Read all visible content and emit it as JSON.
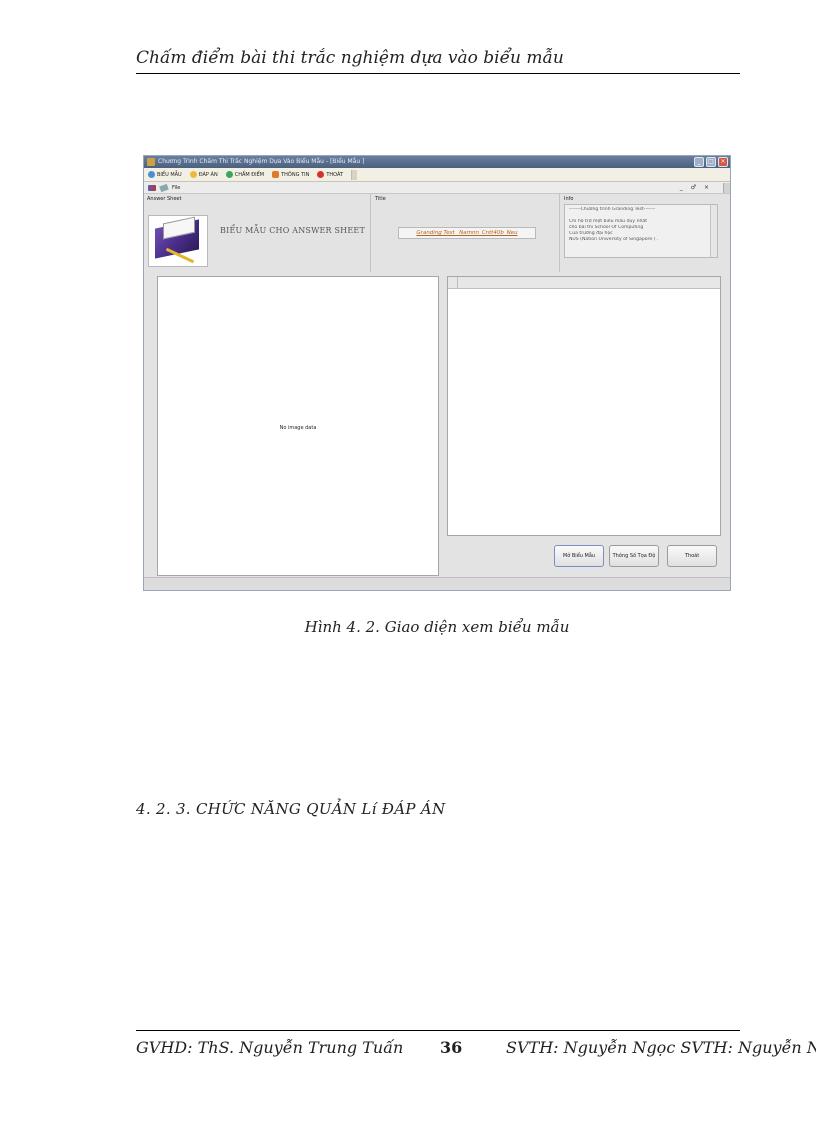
{
  "header": {
    "title": "Chấm điểm bài thi trắc nghiệm dựa vào biểu mẫu"
  },
  "app": {
    "window_title": "Chương Trình Chấm Thi Trắc Nghiệm Dựa Vào Biểu Mẫu - [Biểu Mẫu ]",
    "menu": [
      {
        "label": "BIỂU MẪU",
        "icon": "form-icon"
      },
      {
        "label": "ĐÁP ÁN",
        "icon": "answer-icon"
      },
      {
        "label": "CHẤM ĐIỂM",
        "icon": "grade-icon"
      },
      {
        "label": "THÔNG TIN",
        "icon": "info-icon"
      },
      {
        "label": "THOÁT",
        "icon": "exit-icon"
      }
    ],
    "subbar": {
      "file_label": "File",
      "controls": "_ ♂ ×"
    },
    "panels": {
      "answer_sheet_label": "Answer Sheet",
      "title_label": "Title",
      "info_label": "Info"
    },
    "form_caption": "BIỂU MẪU CHO ANSWER SHEET",
    "title_value": "Granding Test _Namnn_Cntt40b_Neu",
    "info_lines": [
      "-------Chương trình Granding Test-------",
      "",
      "Chỉ hỗ trợ một biểu mẫu duy nhất",
      "cho bài thi School Of Computing",
      "Của trường đại học",
      "NUS (Nation University of Singapore ) ."
    ],
    "no_image_text": "No image data",
    "buttons": {
      "open": "Mở Biểu Mẫu",
      "coords": "Thông Số Tọa Độ",
      "exit": "Thoát"
    }
  },
  "figure_caption": "Hình 4. 2. Giao diện xem biểu mẫu",
  "section_heading": "4. 2. 3. CHỨC NĂNG QUẢN Lí ĐÁP ÁN",
  "footer": {
    "left": "GVHD: ThS. Nguyễn Trung Tuấn",
    "page_number": "36",
    "right": "SVTH: Nguyễn Ngọc SVTH: Nguyễn Ngọc"
  }
}
